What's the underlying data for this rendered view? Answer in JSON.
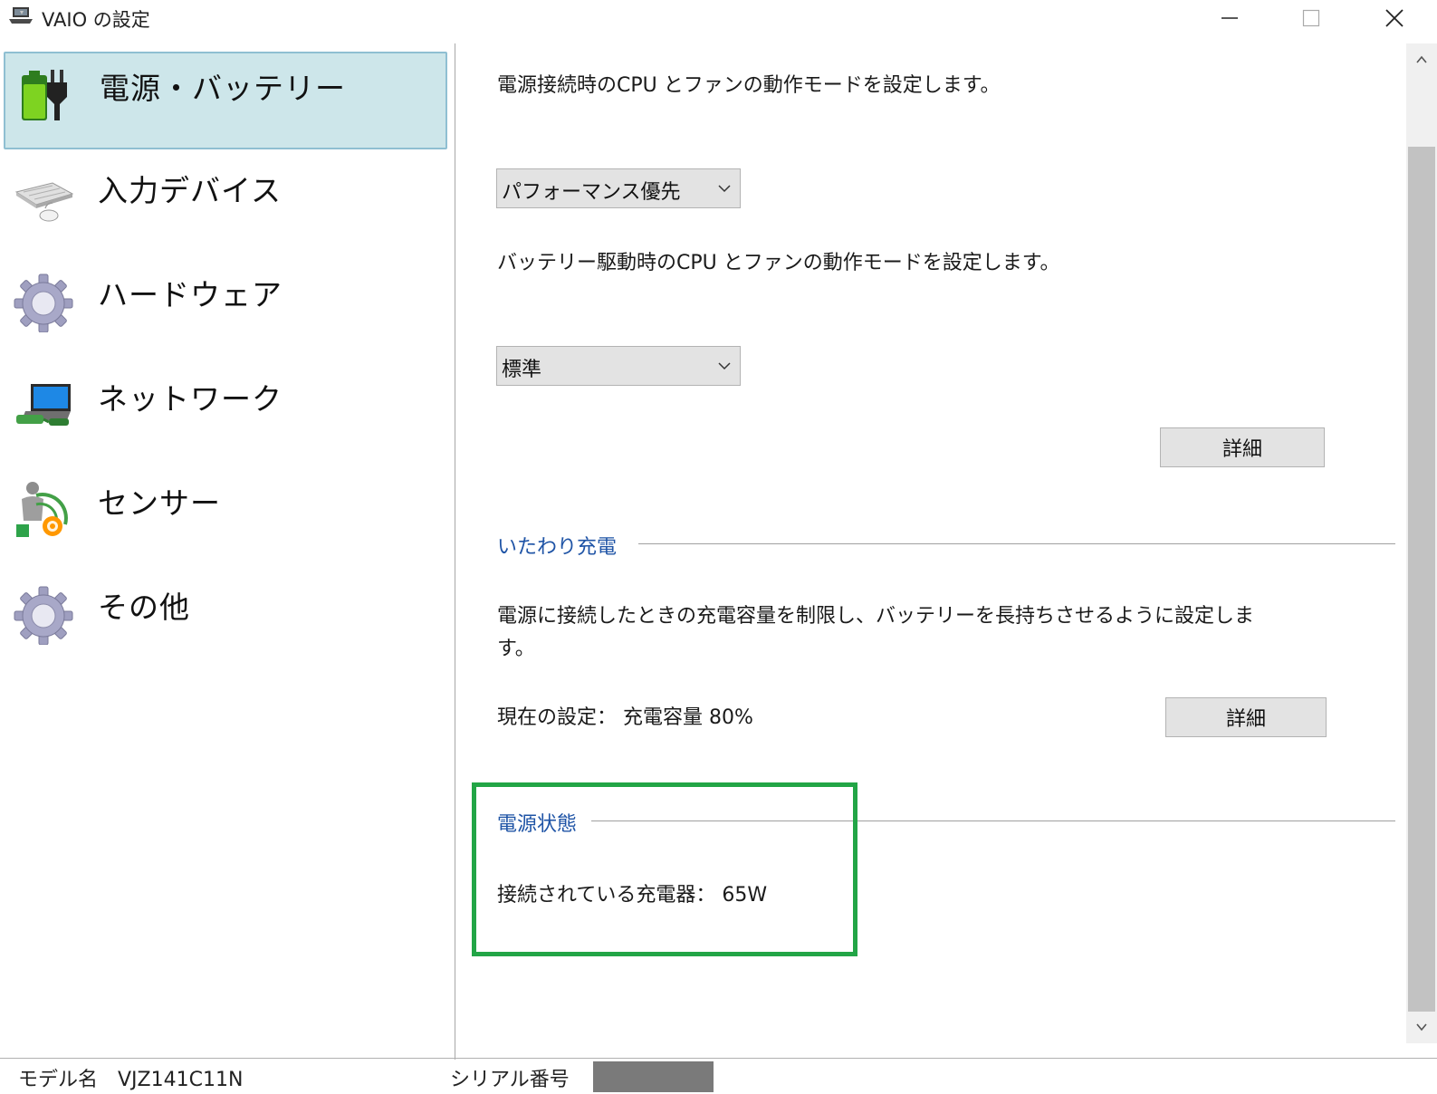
{
  "window": {
    "title": "VAIO の設定",
    "minimize_glyph": "—",
    "close_glyph": "✕"
  },
  "sidebar": {
    "items": [
      {
        "label": "電源・バッテリー",
        "icon": "battery-plug-icon",
        "selected": true
      },
      {
        "label": "入力デバイス",
        "icon": "keyboard-mouse-icon",
        "selected": false
      },
      {
        "label": "ハードウェア",
        "icon": "gear-icon",
        "selected": false
      },
      {
        "label": "ネットワーク",
        "icon": "network-laptop-icon",
        "selected": false
      },
      {
        "label": "センサー",
        "icon": "sensor-person-icon",
        "selected": false
      },
      {
        "label": "その他",
        "icon": "gear-icon",
        "selected": false
      }
    ]
  },
  "main": {
    "ac_description": "電源接続時のCPU とファンの動作モードを設定します。",
    "ac_mode": "パフォーマンス優先",
    "battery_description": "バッテリー駆動時のCPU とファンの動作モードを設定します。",
    "battery_mode": "標準",
    "details_label": "詳細",
    "care_charge": {
      "heading": "いたわり充電",
      "description_line1": "電源に接続したときの充電容量を制限し、バッテリーを長持ちさせるように設定しま",
      "description_line2": "す。",
      "current_setting": "現在の設定： 充電容量 80%",
      "details_label": "詳細"
    },
    "power_status": {
      "heading": "電源状態",
      "charger": "接続されている充電器： 65W"
    }
  },
  "footer": {
    "model_label": "モデル名　VJZ141C11N",
    "serial_label": "シリアル番号"
  },
  "colors": {
    "selected_bg": "#cde6ea",
    "section_heading": "#1f54a6",
    "highlight_border": "#22a546"
  }
}
